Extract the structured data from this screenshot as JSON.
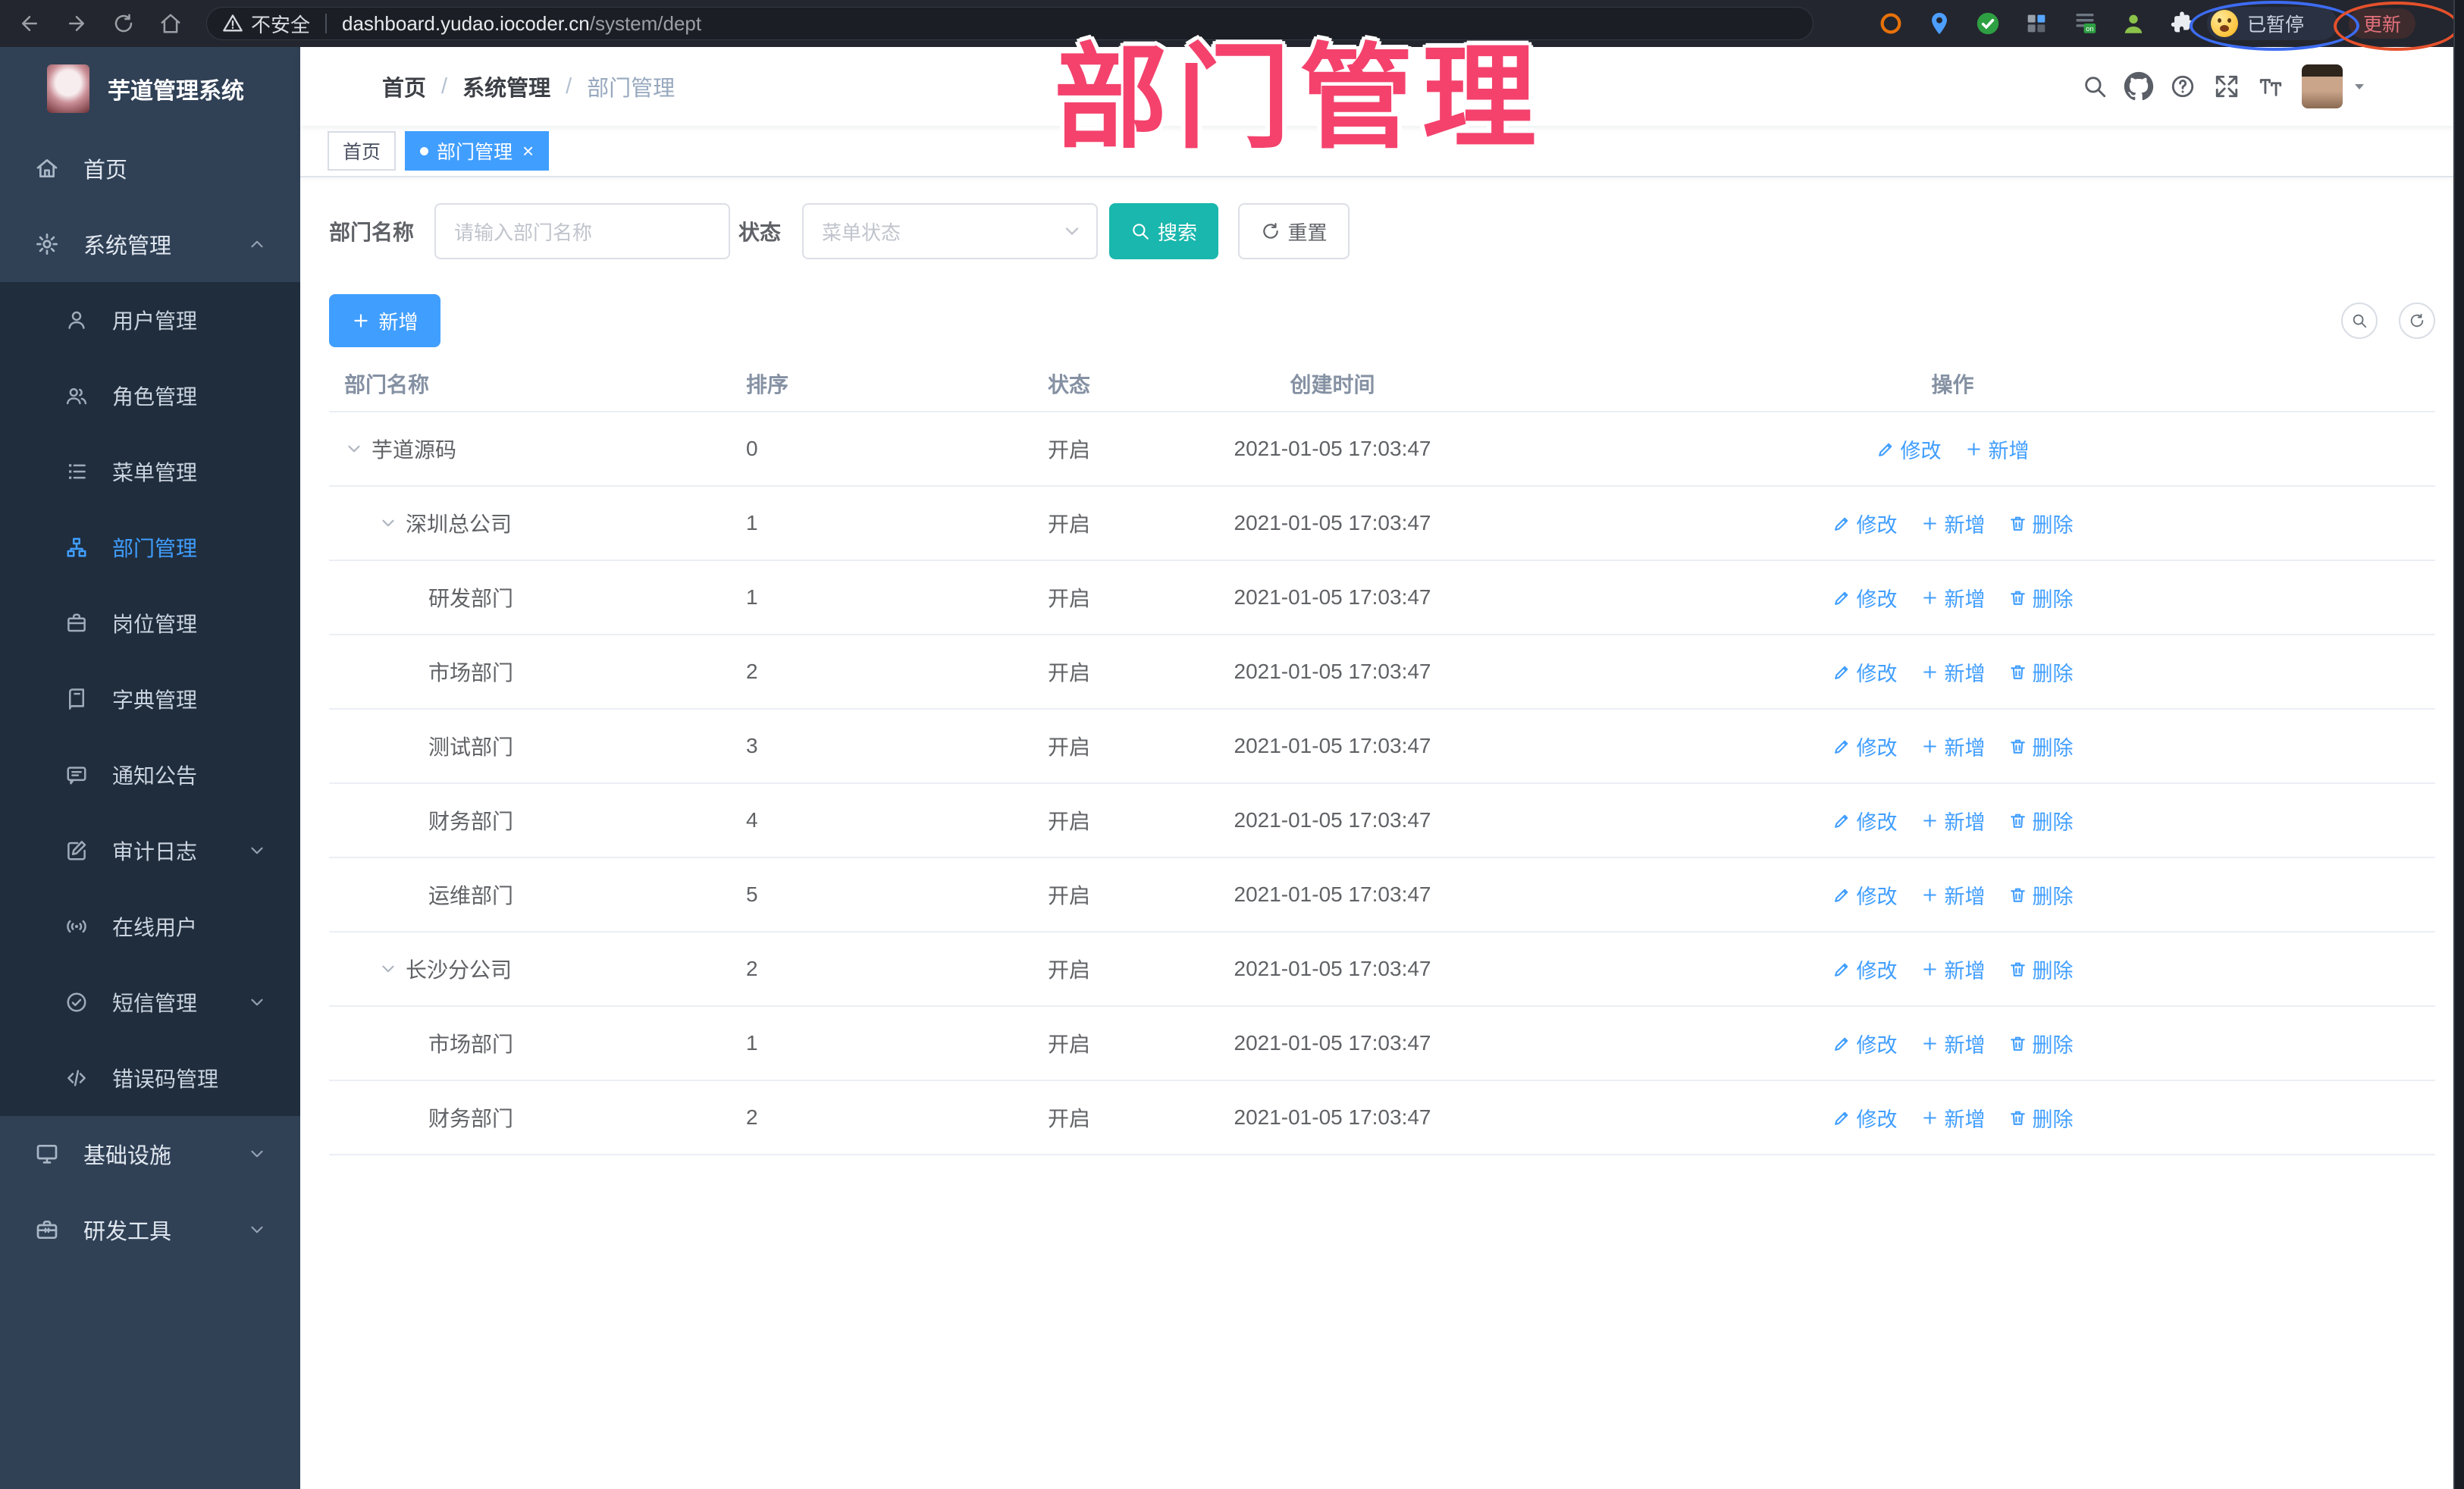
{
  "browser": {
    "security_label": "不安全",
    "url_host": "dashboard.yudao.iocoder.cn",
    "url_path": "/system/dept",
    "paused_label": "已暂停",
    "update_label": "更新",
    "nav_icons": [
      "back-icon",
      "forward-icon",
      "reload-icon",
      "home-chrome-icon"
    ],
    "extension_icons": [
      "orange-ring-extension-icon",
      "pin-extension-icon",
      "check-extension-icon",
      "grid-extension-icon",
      "onpage-extension-icon",
      "person-extension-icon",
      "puzzle-extension-icon"
    ]
  },
  "annotation": {
    "title": "部门管理",
    "color": "#f4426d"
  },
  "sidebar": {
    "logo_title": "芋道管理系统",
    "menu": [
      {
        "id": "home",
        "label": "首页",
        "icon": "home-icon"
      },
      {
        "id": "system",
        "label": "系统管理",
        "icon": "gear-icon",
        "expanded": true,
        "children": [
          {
            "id": "user",
            "label": "用户管理",
            "icon": "user-icon"
          },
          {
            "id": "role",
            "label": "角色管理",
            "icon": "users-icon"
          },
          {
            "id": "menu",
            "label": "菜单管理",
            "icon": "menu-list-icon"
          },
          {
            "id": "dept",
            "label": "部门管理",
            "icon": "org-tree-icon",
            "active": true
          },
          {
            "id": "post",
            "label": "岗位管理",
            "icon": "briefcase-icon"
          },
          {
            "id": "dict",
            "label": "字典管理",
            "icon": "book-icon"
          },
          {
            "id": "notice",
            "label": "通知公告",
            "icon": "announcement-icon"
          },
          {
            "id": "auditlog",
            "label": "审计日志",
            "icon": "audit-log-icon",
            "collapsible": true
          },
          {
            "id": "online",
            "label": "在线用户",
            "icon": "online-user-icon"
          },
          {
            "id": "sms",
            "label": "短信管理",
            "icon": "sms-icon",
            "collapsible": true
          },
          {
            "id": "errcode",
            "label": "错误码管理",
            "icon": "code-icon"
          }
        ]
      },
      {
        "id": "infra",
        "label": "基础设施",
        "icon": "monitor-icon",
        "collapsible": true
      },
      {
        "id": "devtool",
        "label": "研发工具",
        "icon": "toolbox-icon",
        "collapsible": true
      }
    ]
  },
  "header": {
    "breadcrumb": [
      "首页",
      "系统管理",
      "部门管理"
    ],
    "action_icons": [
      "search-icon",
      "github-icon",
      "help-icon",
      "fullscreen-icon",
      "font-size-icon"
    ]
  },
  "tags": [
    {
      "label": "首页",
      "active": false,
      "closable": false
    },
    {
      "label": "部门管理",
      "active": true,
      "closable": true
    }
  ],
  "filter": {
    "name_label": "部门名称",
    "name_placeholder": "请输入部门名称",
    "status_label": "状态",
    "status_placeholder": "菜单状态",
    "search_label": "搜索",
    "reset_label": "重置"
  },
  "toolbar": {
    "add_label": "新增"
  },
  "table": {
    "columns": [
      "部门名称",
      "排序",
      "状态",
      "创建时间",
      "操作"
    ],
    "action_labels": {
      "edit": "修改",
      "add": "新增",
      "delete": "删除"
    },
    "rows": [
      {
        "name": "芋道源码",
        "level": 0,
        "expandable": true,
        "sort": "0",
        "status": "开启",
        "created": "2021-01-05 17:03:47",
        "actions": [
          "edit",
          "add"
        ]
      },
      {
        "name": "深圳总公司",
        "level": 1,
        "expandable": true,
        "sort": "1",
        "status": "开启",
        "created": "2021-01-05 17:03:47",
        "actions": [
          "edit",
          "add",
          "delete"
        ]
      },
      {
        "name": "研发部门",
        "level": 2,
        "expandable": false,
        "sort": "1",
        "status": "开启",
        "created": "2021-01-05 17:03:47",
        "actions": [
          "edit",
          "add",
          "delete"
        ]
      },
      {
        "name": "市场部门",
        "level": 2,
        "expandable": false,
        "sort": "2",
        "status": "开启",
        "created": "2021-01-05 17:03:47",
        "actions": [
          "edit",
          "add",
          "delete"
        ]
      },
      {
        "name": "测试部门",
        "level": 2,
        "expandable": false,
        "sort": "3",
        "status": "开启",
        "created": "2021-01-05 17:03:47",
        "actions": [
          "edit",
          "add",
          "delete"
        ]
      },
      {
        "name": "财务部门",
        "level": 2,
        "expandable": false,
        "sort": "4",
        "status": "开启",
        "created": "2021-01-05 17:03:47",
        "actions": [
          "edit",
          "add",
          "delete"
        ]
      },
      {
        "name": "运维部门",
        "level": 2,
        "expandable": false,
        "sort": "5",
        "status": "开启",
        "created": "2021-01-05 17:03:47",
        "actions": [
          "edit",
          "add",
          "delete"
        ]
      },
      {
        "name": "长沙分公司",
        "level": 1,
        "expandable": true,
        "sort": "2",
        "status": "开启",
        "created": "2021-01-05 17:03:47",
        "actions": [
          "edit",
          "add",
          "delete"
        ]
      },
      {
        "name": "市场部门",
        "level": 2,
        "expandable": false,
        "sort": "1",
        "status": "开启",
        "created": "2021-01-05 17:03:47",
        "actions": [
          "edit",
          "add",
          "delete"
        ]
      },
      {
        "name": "财务部门",
        "level": 2,
        "expandable": false,
        "sort": "2",
        "status": "开启",
        "created": "2021-01-05 17:03:47",
        "actions": [
          "edit",
          "add",
          "delete"
        ]
      }
    ]
  },
  "colors": {
    "primary": "#409eff",
    "search_button": "#19b7ad",
    "sidebar_bg": "#304156",
    "submenu_bg": "#1f2d3d",
    "annotation_pink": "#f4426d",
    "chrome_bg": "#23262e"
  }
}
